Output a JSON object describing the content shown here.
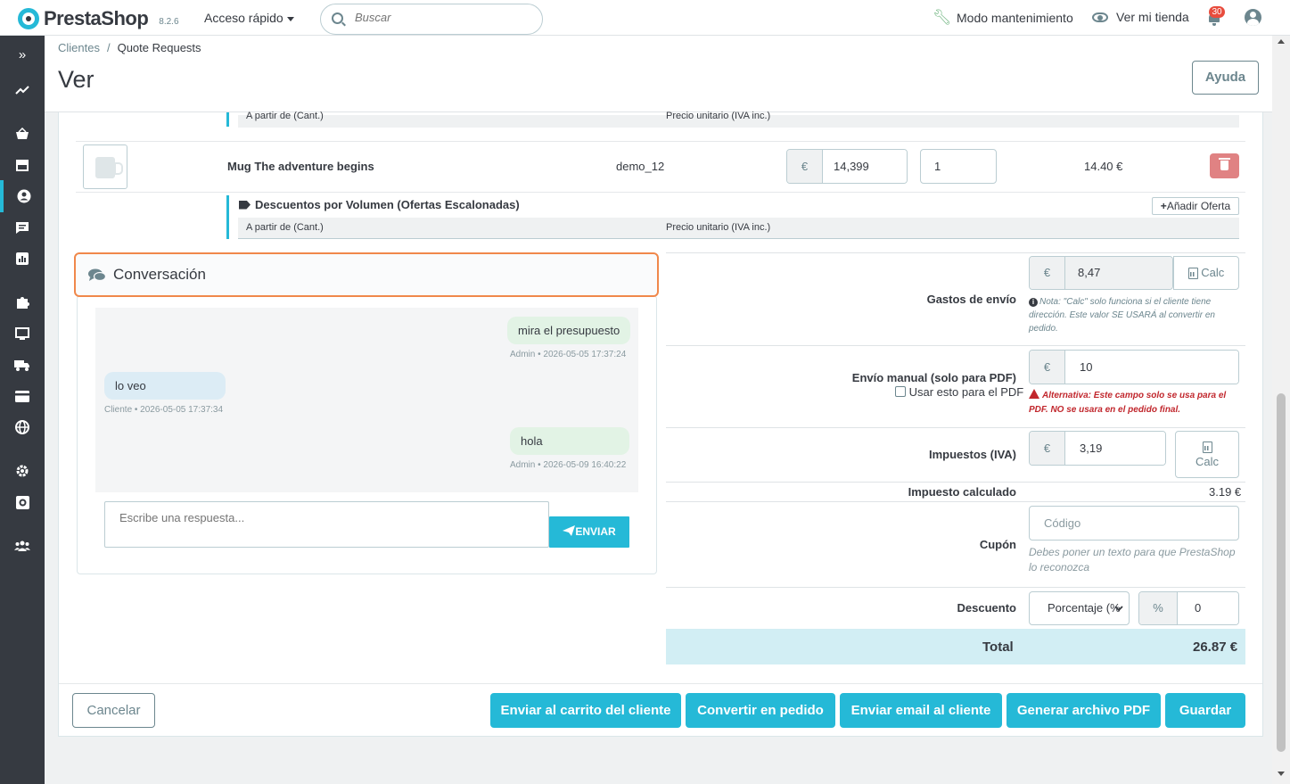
{
  "app": {
    "name": "PrestaShop",
    "version": "8.2.6",
    "quick_access": "Acceso rápido",
    "search_placeholder": "Buscar",
    "maintenance": "Modo mantenimiento",
    "view_shop": "Ver mi tienda",
    "notifications_count": "30"
  },
  "breadcrumb": {
    "parent": "Clientes",
    "separator": "/",
    "current": "Quote Requests"
  },
  "page": {
    "title": "Ver",
    "help_label": "Ayuda"
  },
  "tier_headers": {
    "from_qty": "A partir de (Cant.)",
    "unit_price": "Precio unitario (IVA inc.)"
  },
  "product": {
    "name": "Mug The adventure begins",
    "reference": "demo_12",
    "currency": "€",
    "price": "14,399",
    "quantity": "1",
    "row_total": "14.40 €"
  },
  "volume_discounts": {
    "title": "Descuentos por Volumen (Ofertas Escalonadas)",
    "add_offer": "Añadir Oferta"
  },
  "conversation": {
    "title": "Conversación",
    "messages": [
      {
        "text": "mira el presupuesto",
        "meta": "Admin • 2026-05-05 17:37:24",
        "from": "admin"
      },
      {
        "text": "lo veo",
        "meta": "Cliente • 2026-05-05 17:37:34",
        "from": "client"
      },
      {
        "text": "hola",
        "meta": "Admin • 2026-05-09 16:40:22",
        "from": "admin"
      }
    ],
    "reply_placeholder": "Escribe una respuesta...",
    "send_label": "ENVIAR"
  },
  "totals": {
    "shipping": {
      "label": "Gastos de envío",
      "currency": "€",
      "value": "8,47",
      "calc": "Calc",
      "note": "Nota: \"Calc\" solo funciona si el cliente tiene dirección. Este valor SE USARÁ al convertir en pedido."
    },
    "manual_shipping": {
      "label": "Envío manual (solo para PDF)",
      "checkbox_label": "Usar esto para el PDF",
      "currency": "€",
      "value": "10",
      "warning": "Alternativa: Este campo solo se usa para el PDF. NO se usara en el pedido final."
    },
    "taxes": {
      "label": "Impuestos (IVA)",
      "currency": "€",
      "value": "3,19",
      "calc": "Calc"
    },
    "computed_tax": {
      "label": "Impuesto calculado",
      "value": "3.19 €"
    },
    "coupon": {
      "label": "Cupón",
      "placeholder": "Código",
      "hint": "Debes poner un texto para que PrestaShop lo reconozca"
    },
    "discount": {
      "label": "Descuento",
      "type": "Porcentaje (%",
      "symbol": "%",
      "value": "0"
    },
    "total": {
      "label": "Total",
      "value": "26.87 €"
    }
  },
  "footer": {
    "cancel": "Cancelar",
    "send_to_cart": "Enviar al carrito del cliente",
    "convert": "Convertir en pedido",
    "email": "Enviar email al cliente",
    "pdf": "Generar archivo PDF",
    "save": "Guardar"
  },
  "colors": {
    "primary": "#25b9d7",
    "sidebar": "#363a41",
    "danger": "#e08283",
    "highlight": "#f0884b",
    "total_bg": "#d2eef4"
  }
}
